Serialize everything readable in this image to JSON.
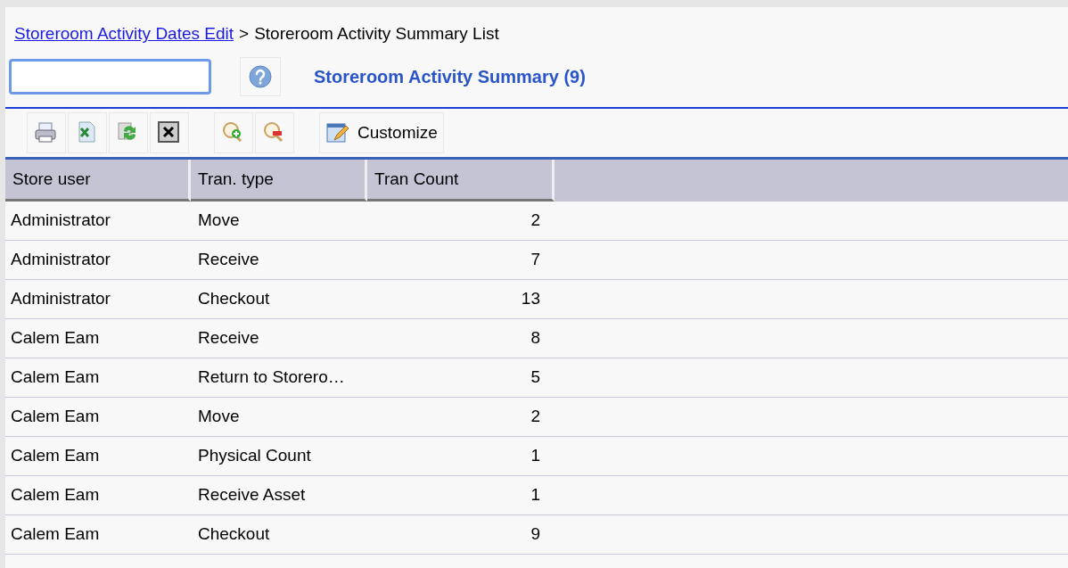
{
  "breadcrumb": {
    "link": "Storeroom Activity Dates Edit",
    "separator": ">",
    "current": "Storeroom Activity Summary List"
  },
  "title": "Storeroom Activity Summary (9)",
  "toolbar": [
    {
      "kind": "print"
    },
    {
      "kind": "excel"
    },
    {
      "kind": "refresh"
    },
    {
      "kind": "delete"
    },
    {
      "kind": "zoom-in"
    },
    {
      "kind": "zoom-out"
    },
    {
      "kind": "customize",
      "label": "Customize"
    }
  ],
  "table": {
    "columns": [
      "Store user",
      "Tran. type",
      "Tran Count"
    ],
    "rows": [
      [
        "Administrator",
        "Move",
        "2"
      ],
      [
        "Administrator",
        "Receive",
        "7"
      ],
      [
        "Administrator",
        "Checkout",
        "13"
      ],
      [
        "Calem Eam",
        "Receive",
        "8"
      ],
      [
        "Calem Eam",
        "Return to Storero…",
        "5"
      ],
      [
        "Calem Eam",
        "Move",
        "2"
      ],
      [
        "Calem Eam",
        "Physical Count",
        "1"
      ],
      [
        "Calem Eam",
        "Receive Asset",
        "1"
      ],
      [
        "Calem Eam",
        "Checkout",
        "9"
      ]
    ]
  }
}
